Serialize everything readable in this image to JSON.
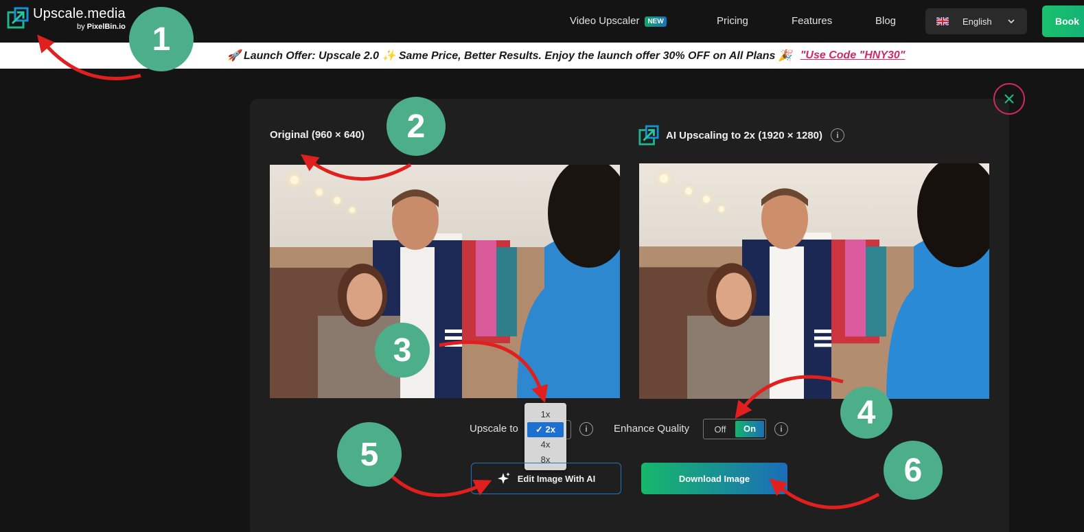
{
  "header": {
    "logo": {
      "title": "Upscale.media",
      "by": "by",
      "brand": "PixelBin.io"
    },
    "nav": {
      "video_upscaler": "Video Upscaler",
      "new_badge": "NEW",
      "pricing": "Pricing",
      "features": "Features",
      "blog": "Blog"
    },
    "language": {
      "flag": "uk-flag-icon",
      "selected": "English"
    },
    "book_button": "Book"
  },
  "offer_banner": {
    "text": "🚀 Launch Offer: Upscale 2.0 ✨ Same Price, Better Results. Enjoy the launch offer 30% OFF on All Plans 🎉",
    "code": "\"Use Code \"HNY30\""
  },
  "comparison": {
    "original_label": "Original (960 × 640)",
    "upscaled_label": "AI Upscaling to 2x (1920 × 1280)"
  },
  "controls": {
    "upscale_label": "Upscale to",
    "upscale_options": [
      "1x",
      "✓ 2x",
      "4x",
      "8x"
    ],
    "upscale_selected": "2x",
    "enhance_label": "Enhance Quality",
    "enhance_off": "Off",
    "enhance_on": "On",
    "enhance_value": "On",
    "info_symbol": "i",
    "edit_button": "Edit Image With AI",
    "download_button": "Download Image"
  },
  "annotations": {
    "markers": [
      "1",
      "2",
      "3",
      "4",
      "5",
      "6"
    ]
  },
  "colors": {
    "background": "#141414",
    "panel": "#1f1f1f",
    "accent_green": "#16b86b",
    "accent_blue": "#1b6db8",
    "marker": "#4daf8a",
    "arrow": "#e0201e",
    "offer_code": "#d12868",
    "close_ring": "#d02a55"
  }
}
